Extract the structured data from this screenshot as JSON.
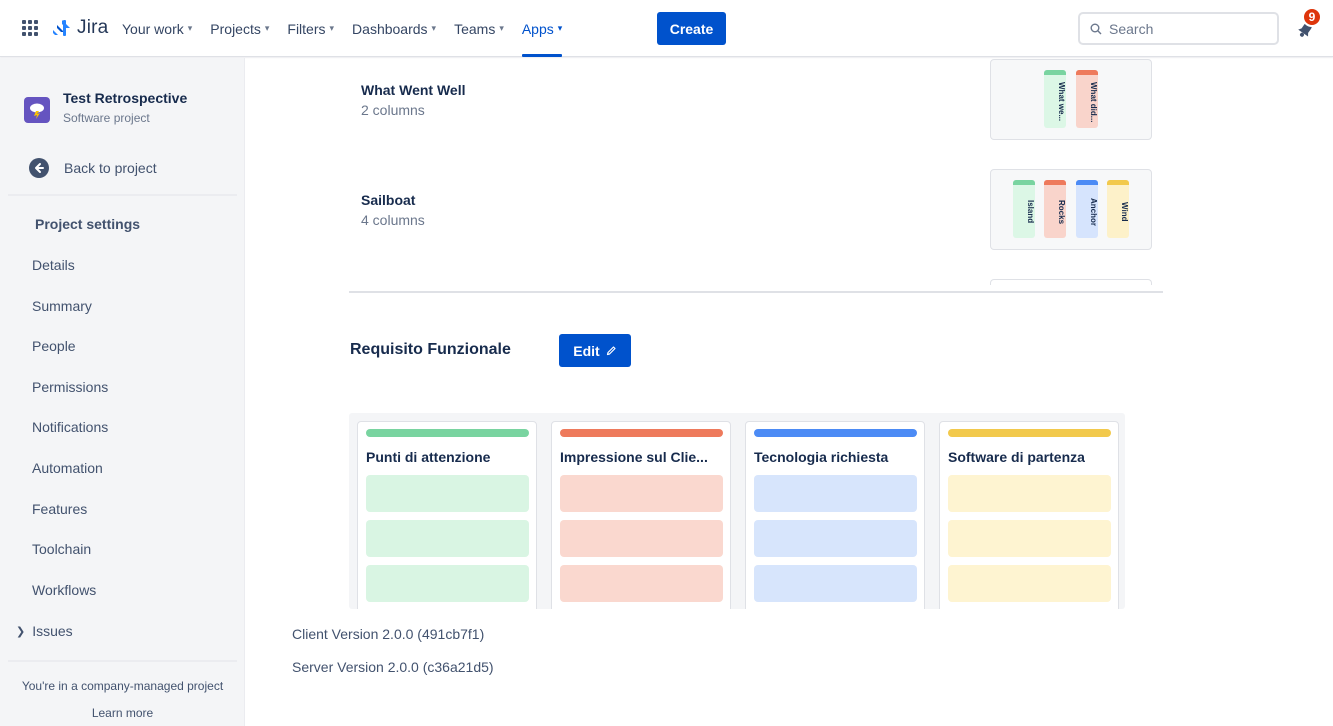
{
  "app": {
    "name": "Jira"
  },
  "nav": {
    "items": [
      {
        "label": "Your work",
        "active": false
      },
      {
        "label": "Projects",
        "active": false
      },
      {
        "label": "Filters",
        "active": false
      },
      {
        "label": "Dashboards",
        "active": false
      },
      {
        "label": "Teams",
        "active": false
      },
      {
        "label": "Apps",
        "active": true
      }
    ],
    "create_label": "Create",
    "search_placeholder": "Search",
    "notification_count": "9"
  },
  "sidebar": {
    "project_name": "Test Retrospective",
    "project_type": "Software project",
    "back_label": "Back to project",
    "settings_title": "Project settings",
    "items": [
      "Details",
      "Summary",
      "People",
      "Permissions",
      "Notifications",
      "Automation",
      "Features",
      "Toolchain",
      "Workflows"
    ],
    "issues_label": "Issues",
    "company_note": "You're in a company-managed project",
    "learn_more": "Learn more"
  },
  "templates": [
    {
      "title": "What Went Well",
      "subtitle": "2 columns",
      "columns": [
        {
          "label": "What we...",
          "color": "green"
        },
        {
          "label": "What did...",
          "color": "red"
        }
      ]
    },
    {
      "title": "Sailboat",
      "subtitle": "4 columns",
      "columns": [
        {
          "label": "Island",
          "color": "green"
        },
        {
          "label": "Rocks",
          "color": "red"
        },
        {
          "label": "Anchor",
          "color": "blue"
        },
        {
          "label": "Wind",
          "color": "yellow"
        }
      ]
    }
  ],
  "board": {
    "title": "Requisito Funzionale",
    "edit_label": "Edit",
    "columns": [
      {
        "name": "Punti di attenzione",
        "color": "green"
      },
      {
        "name": "Impressione sul Clie...",
        "color": "red"
      },
      {
        "name": "Tecnologia richiesta",
        "color": "blue"
      },
      {
        "name": "Software di partenza",
        "color": "yellow"
      }
    ]
  },
  "footer": {
    "client_version": "Client Version 2.0.0 (491cb7f1)",
    "server_version": "Server Version 2.0.0 (c36a21d5)"
  },
  "colors": {
    "primary": "#0052cc",
    "green": {
      "bar": "#79d4a0",
      "light": "#dcf7e6",
      "card": "#d9f5e3"
    },
    "red": {
      "bar": "#ee7a5c",
      "light": "#f9d4cb",
      "card": "#fad8cf"
    },
    "blue": {
      "bar": "#4c8bf5",
      "light": "#d6e4fd",
      "card": "#d7e5fc"
    },
    "yellow": {
      "bar": "#f2c94c",
      "light": "#fdf1c9",
      "card": "#fef4d1"
    }
  }
}
